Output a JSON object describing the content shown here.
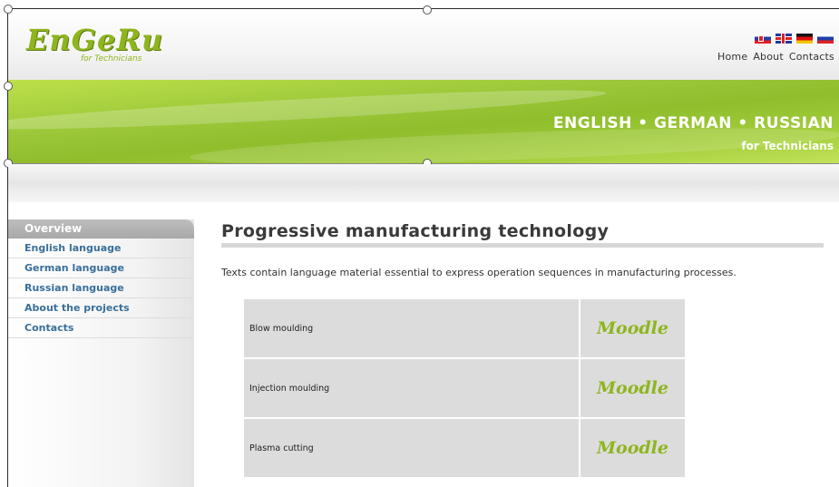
{
  "logo": {
    "main": "EnGeRu",
    "sub": "for Technicians"
  },
  "flags": [
    "slovak-flag",
    "uk-flag",
    "german-flag",
    "russian-flag"
  ],
  "topnav": [
    "Home",
    "About",
    "Contacts"
  ],
  "banner": {
    "title": "ENGLISH • GERMAN • RUSSIAN",
    "subtitle": "for Technicians"
  },
  "sidebar": {
    "header": "Overview",
    "items": [
      "English language",
      "German language",
      "Russian language",
      "About the projects",
      "Contacts"
    ]
  },
  "main": {
    "title": "Progressive manufacturing technology",
    "intro": "Texts contain language material essential to express operation sequences in manufacturing processes.",
    "rows": [
      {
        "name": "Blow moulding",
        "link": "Moodle"
      },
      {
        "name": "Injection moulding",
        "link": "Moodle"
      },
      {
        "name": "Plasma cutting",
        "link": "Moodle"
      }
    ]
  },
  "colors": {
    "accent": "#8fb51e",
    "link": "#3a6f9a",
    "sidebar_header": "#b3b3b3"
  }
}
